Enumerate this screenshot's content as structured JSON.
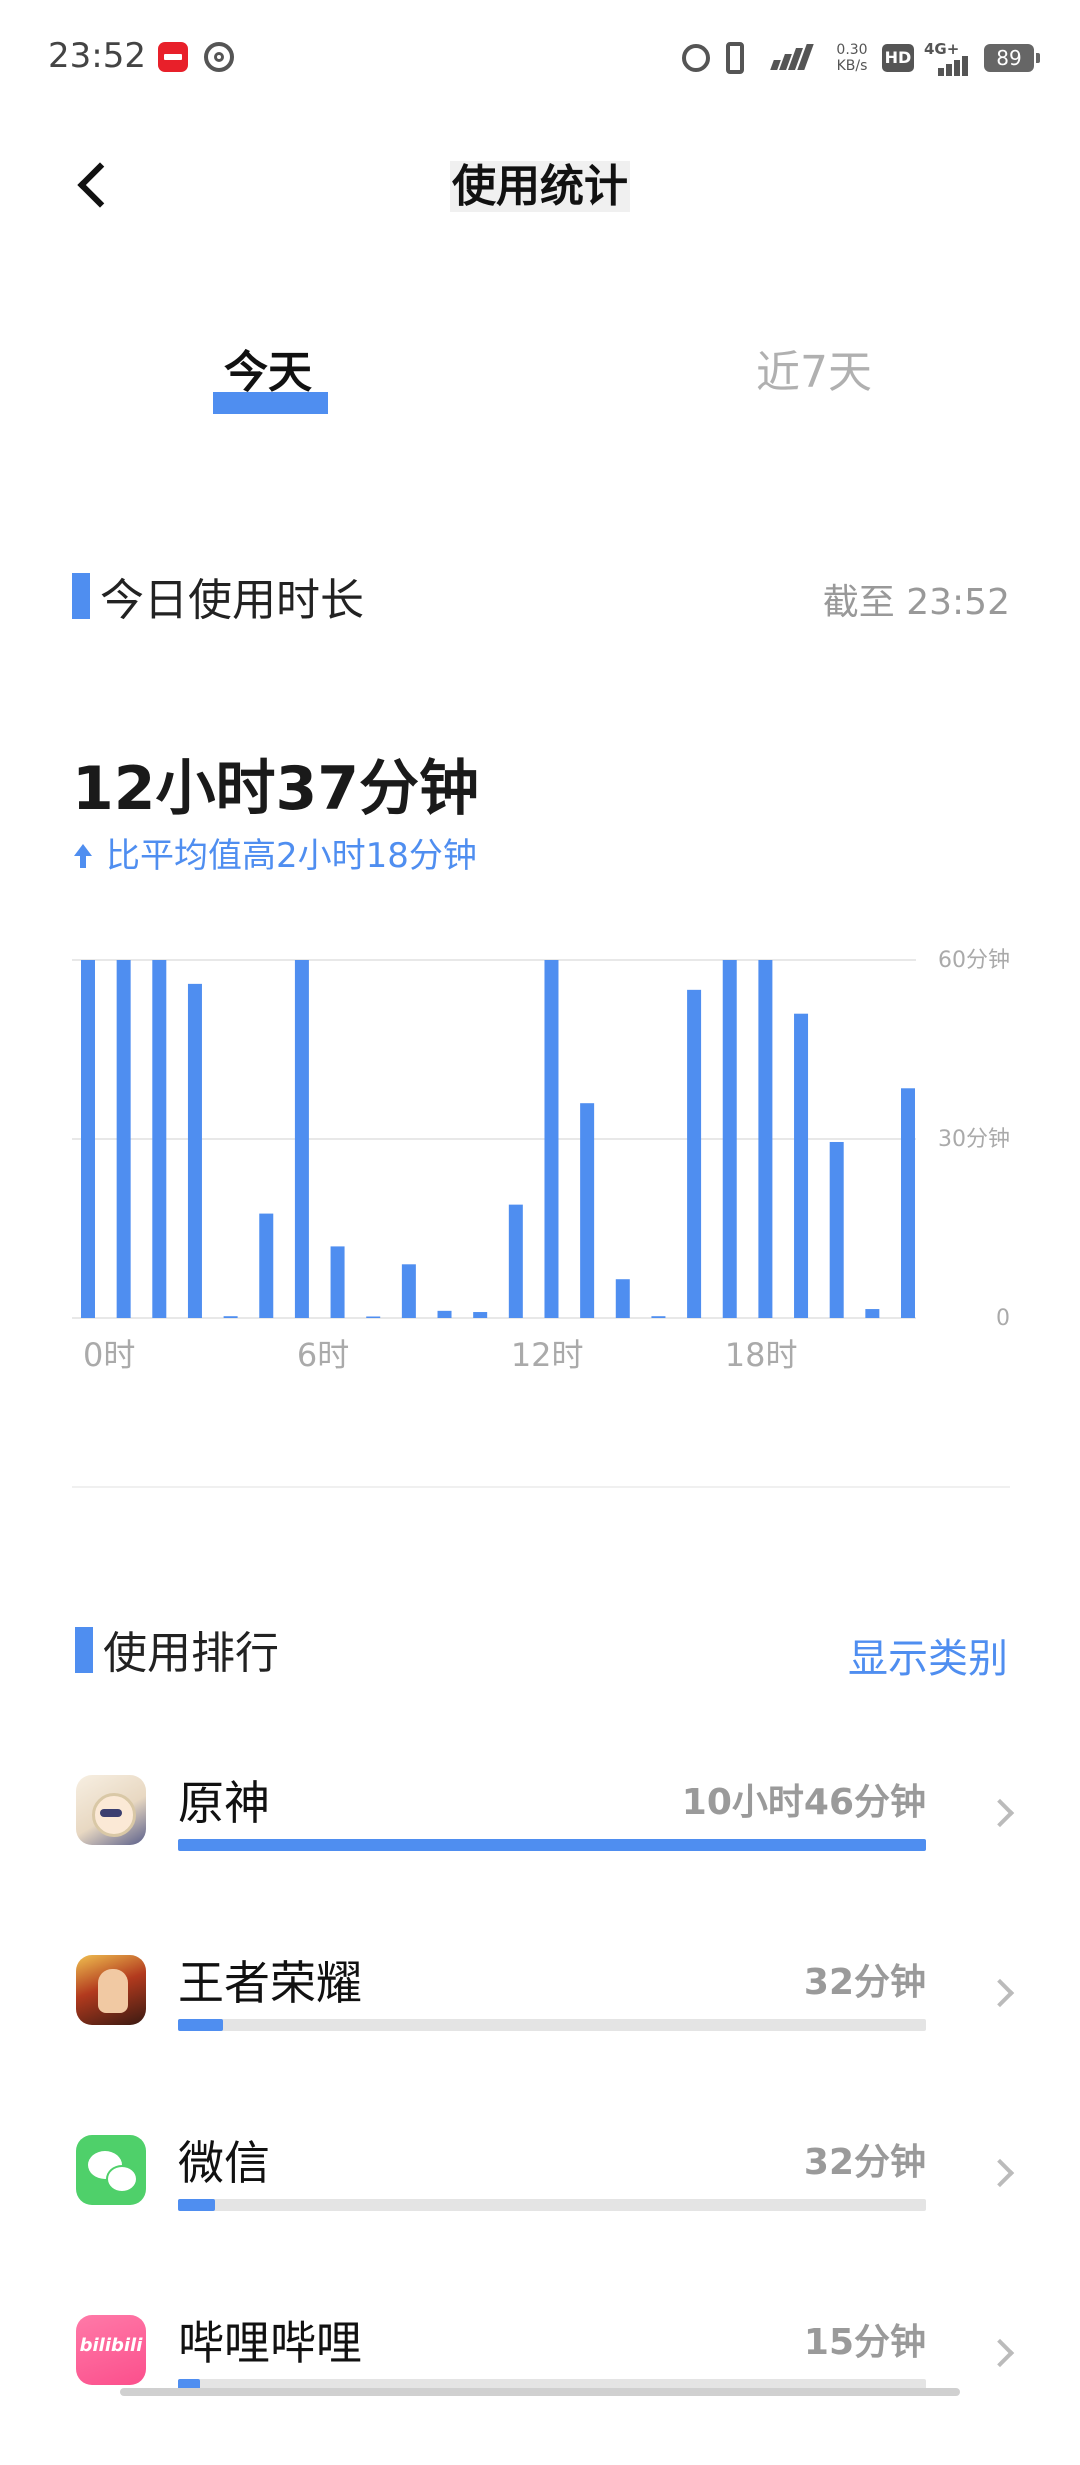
{
  "status_bar": {
    "time": "23:52",
    "speed_value": "0.30",
    "speed_unit": "KB/s",
    "hd": "HD",
    "network": "4G+",
    "battery": "89"
  },
  "header": {
    "title": "使用统计"
  },
  "tabs": [
    {
      "label": "今天",
      "active": true
    },
    {
      "label": "近7天",
      "active": false
    }
  ],
  "today": {
    "section_title": "今日使用时长",
    "cutoff": "截至 23:52",
    "total": "12小时37分钟",
    "compare": "比平均值高2小时18分钟"
  },
  "chart_data": {
    "type": "bar",
    "categories": [
      "0",
      "1",
      "2",
      "3",
      "4",
      "5",
      "6",
      "7",
      "8",
      "9",
      "10",
      "11",
      "12",
      "13",
      "14",
      "15",
      "16",
      "17",
      "18",
      "19",
      "20",
      "21",
      "22",
      "23"
    ],
    "values": [
      60,
      60,
      60,
      56,
      0.3,
      17.5,
      60,
      12,
      0,
      9,
      1.2,
      1,
      19,
      60,
      36,
      6.5,
      0.3,
      55,
      60,
      60,
      51,
      29.5,
      1.5,
      38.5
    ],
    "xticks": [
      {
        "index": 0,
        "label": "0时"
      },
      {
        "index": 6,
        "label": "6时"
      },
      {
        "index": 12,
        "label": "12时"
      },
      {
        "index": 18,
        "label": "18时"
      }
    ],
    "yticks": [
      "0",
      "30分钟",
      "60分钟"
    ],
    "ylim": [
      0,
      60
    ],
    "grid": true,
    "color": "#4f8ef0",
    "title": "",
    "xlabel": "",
    "ylabel": ""
  },
  "ranking": {
    "section_title": "使用排行",
    "action_label": "显示类别",
    "apps": [
      {
        "name": "原神",
        "duration": "10小时46分钟",
        "fraction": 1.0,
        "icon": "genshin-icon"
      },
      {
        "name": "王者荣耀",
        "duration": "32分钟",
        "fraction": 0.06,
        "icon": "honor-of-kings-icon"
      },
      {
        "name": "微信",
        "duration": "32分钟",
        "fraction": 0.05,
        "icon": "wechat-icon"
      },
      {
        "name": "哔哩哔哩",
        "duration": "15分钟",
        "fraction": 0.03,
        "icon": "bilibili-icon",
        "icon_text": "bilibili"
      }
    ]
  },
  "colors": {
    "accent": "#4f8ef0",
    "track": "#e4e4e4",
    "muted": "#999999"
  }
}
